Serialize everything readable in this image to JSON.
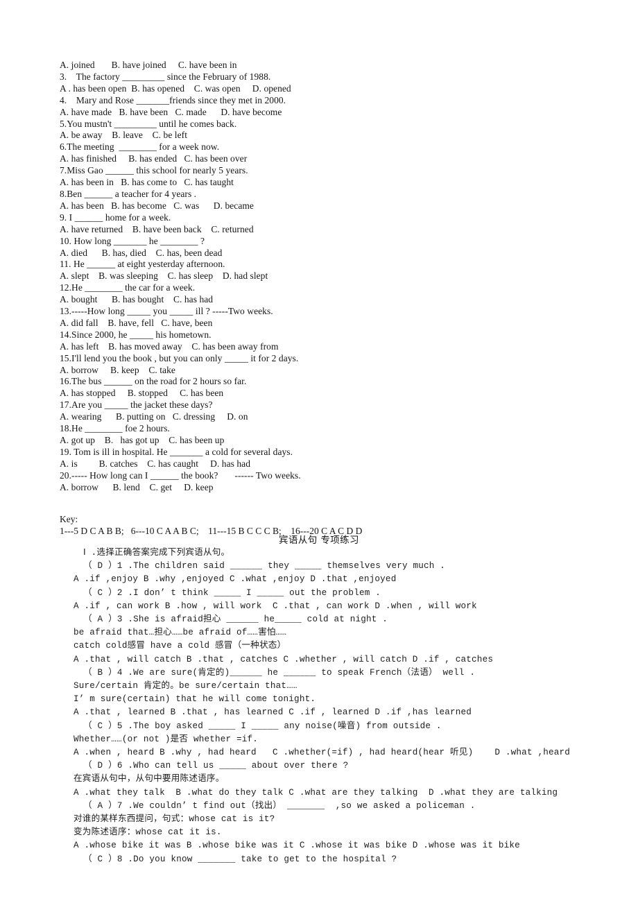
{
  "document": {
    "background_color": "#ffffff",
    "text_color": "#151515",
    "title_cn": "宾语从句 专项练习"
  },
  "section_present_perfect": {
    "name": "present-perfect-multiple-choice",
    "lines": [
      "A. joined       B. have joined     C. have been in",
      "3.    The factory _________ since the February of 1988.",
      "A . has been open  B. has opened    C. was open     D. opened",
      "4.    Mary and Rose _______friends since they met in 2000.",
      "A. have made   B. have been   C. made      D. have become",
      "5.You mustn't _________ until he comes back.",
      "A. be away    B. leave    C. be left",
      "6.The meeting  ________ for a week now.",
      "A. has finished     B. has ended   C. has been over",
      "7.Miss Gao ______ this school for nearly 5 years.",
      "A. has been in   B. has come to   C. has taught",
      "8.Ben ______ a teacher for 4 years .",
      "A. has been   B. has become   C. was      D. became",
      "9. I ______ home for a week.",
      "A. have returned    B. have been back    C. returned",
      "10. How long _______ he ________ ?",
      "A. died      B. has, died    C. has, been dead",
      "11. He ______ at eight yesterday afternoon.",
      "A. slept    B. was sleeping    C. has sleep    D. had slept",
      "12.He ________ the car for a week.",
      "A. bought      B. has bought    C. has had",
      "13.-----How long _____ you _____ ill ? -----Two weeks.",
      "A. did fall    B. have, fell   C. have, been",
      "14.Since 2000, he _____ his hometown.",
      "A. has left    B. has moved away    C. has been away from",
      "15.I'll lend you the book , but you can only _____ it for 2 days.",
      "A. borrow     B. keep    C. take",
      "16.The bus ______ on the road for 2 hours so far.",
      "A. has stopped     B. stopped     C. has been",
      "17.Are you _____ the jacket these days?",
      "A. wearing      B. putting on   C. dressing     D. on",
      "18.He ________ foe 2 hours.",
      "A. got up    B.   has got up    C. has been up",
      "19. Tom is ill in hospital. He _______ a cold for several days.",
      "A. is         B. catches    C. has caught     D. has had",
      "20.----- How long can I ______ the book?       ------ Two weeks.",
      "A. borrow      B. lend    C. get     D. keep"
    ]
  },
  "answer_key": {
    "name": "answer-key",
    "label": "Key:",
    "line": "1---5 D C A B B;   6---10 C A A B C;    11---15 B C C C B;    16---20 C A C D D"
  },
  "section_object_clause": {
    "name": "object-clause-exercises",
    "title": "宾语从句 专项练习",
    "instruction": "Ⅰ .选择正确答案完成下列宾语从句。",
    "lines": [
      "（ D ）1 .The children said ______ they _____ themselves very much .",
      "A .if ,enjoy B .why ,enjoyed C .what ,enjoy D .that ,enjoyed",
      "（ C ）2 .I don’ t think _____ I _____ out the problem .",
      "A .if , can work B .how , will work  C .that , can work D .when , will work",
      "（ A ）3 .She is afraid担心 ______ he_____ cold at night .",
      "be afraid that…担心……be afraid of……害怕……",
      "catch cold感冒 have a cold 感冒（一种状态）",
      "A .that , will catch B .that , catches C .whether , will catch D .if , catches",
      "（ B ）4 .We are sure(肯定的)______ he ______ to speak French（法语） well .",
      "Sure/certain 肯定的。be sure/certain that……",
      "I’ m sure(certain) that he will come tonight.",
      "A .that , learned B .that , has learned C .if , learned D .if ,has learned",
      "（ C ）5 .The boy asked _____ I _____ any noise(噪音) from outside .",
      "Whether……(or not )是否 whether =if.",
      "A .when , heard B .why , had heard   C .whether(=if) , had heard(hear 听见)    D .what ,heard",
      "（ D ）6 .Who can tell us _____ about over there ?",
      "在宾语从句中，从句中要用陈述语序。",
      "A .what they talk  B .what do they talk C .what are they talking  D .what they are talking",
      "（ A ）7 .We couldn’ t find out（找出） _______  ,so we asked a policeman .",
      "对谁的某样东西提问，句式：whose cat is it?",
      "变为陈述语序：whose cat it is.",
      "A .whose bike it was B .whose bike was it C .whose it was bike D .whose was it bike",
      "（ C ）8 .Do you know _______ take to get to the hospital ?"
    ]
  }
}
